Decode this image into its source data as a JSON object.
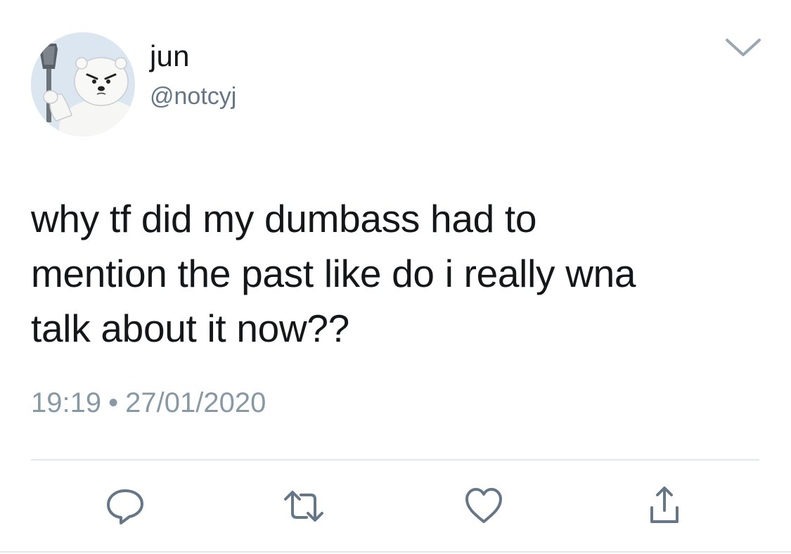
{
  "tweet": {
    "display_name": "jun",
    "handle": "@notcyj",
    "text_lines": [
      "why tf did my dumbass had to",
      "mention the past like do i really wna",
      "talk about it now??"
    ],
    "time": "19:19",
    "separator": "•",
    "date": "27/01/2020"
  },
  "icons": {
    "menu": "chevron-down-icon",
    "reply": "reply-icon",
    "retweet": "retweet-icon",
    "like": "heart-icon",
    "share": "share-icon"
  },
  "colors": {
    "text": "#14171a",
    "secondary": "#657786",
    "meta": "#8899a6",
    "icon": "#657786",
    "divider": "#e1e8ed"
  }
}
